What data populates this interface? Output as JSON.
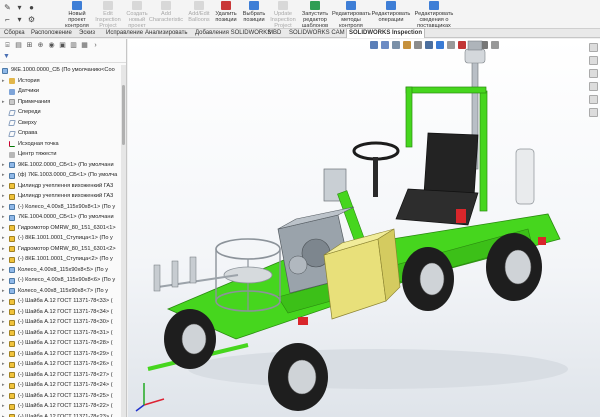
{
  "ribbon": {
    "buttons": [
      {
        "label": "Новый\nпроект\nконтроля",
        "enabled": true,
        "icon": "new-project-icon"
      },
      {
        "label": "Edit\nInspection\nProject",
        "enabled": false,
        "icon": "edit-project-icon"
      },
      {
        "label": "Создать\nновый\nпроект",
        "enabled": false,
        "icon": "create-project-icon"
      },
      {
        "label": "Add\nCharacteristic",
        "enabled": false,
        "icon": "add-characteristic-icon"
      },
      {
        "label": "Add/Edit\nBalloons",
        "enabled": false,
        "icon": "balloons-icon"
      },
      {
        "label": "Удалить\nпозиции",
        "enabled": true,
        "icon": "delete-positions-icon"
      },
      {
        "label": "Выбрать\nпозиции",
        "enabled": true,
        "icon": "select-positions-icon"
      },
      {
        "label": "Update\nInspection\nProject",
        "enabled": false,
        "icon": "update-project-icon"
      },
      {
        "label": "Запустить\nредактор\nшаблонов",
        "enabled": true,
        "icon": "template-editor-icon"
      },
      {
        "label": "Редактировать\nметоды\nконтроля",
        "enabled": true,
        "icon": "edit-methods-icon"
      },
      {
        "label": "Редактировать\nоперации",
        "enabled": true,
        "icon": "edit-operations-icon"
      },
      {
        "label": "Редактировать\nсведения о\nпоставщиках",
        "enabled": true,
        "icon": "edit-suppliers-icon"
      }
    ]
  },
  "tabs": [
    {
      "label": "Сборка",
      "active": false
    },
    {
      "label": "Расположение",
      "active": false
    },
    {
      "label": "Эскиз",
      "active": false
    },
    {
      "label": "Исправление",
      "active": false
    },
    {
      "label": "Анализировать",
      "active": false
    },
    {
      "label": "Добавления SOLIDWORKS",
      "active": false
    },
    {
      "label": "MBD",
      "active": false
    },
    {
      "label": "SOLIDWORKS CAM",
      "active": false
    },
    {
      "label": "SOLIDWORKS Inspection",
      "active": true
    }
  ],
  "tree": {
    "root": "9КЕ.1000.0000_СБ (По умолчанию<Соо",
    "items": [
      {
        "label": "История",
        "icon": "folder-icon",
        "kind": "folder",
        "expand": "▸"
      },
      {
        "label": "Датчики",
        "icon": "sensor-icon",
        "kind": "sensor",
        "expand": ""
      },
      {
        "label": "Примечания",
        "icon": "notes-icon",
        "kind": "note",
        "expand": "▸"
      },
      {
        "label": "Спереди",
        "icon": "plane-icon",
        "kind": "plane",
        "expand": ""
      },
      {
        "label": "Сверху",
        "icon": "plane-icon",
        "kind": "plane",
        "expand": ""
      },
      {
        "label": "Справа",
        "icon": "plane-icon",
        "kind": "plane",
        "expand": ""
      },
      {
        "label": "Исходная точка",
        "icon": "origin-icon",
        "kind": "origin",
        "expand": ""
      },
      {
        "label": "Центр тяжести",
        "icon": "gravity-icon",
        "kind": "gravity",
        "expand": ""
      },
      {
        "label": "9КЕ.1002.0000_СБ<1> (По умолчани",
        "icon": "assembly-icon",
        "kind": "asm",
        "expand": "▸"
      },
      {
        "label": "(ф) 7КЕ.1003.0000_СБ<1> (По умолча",
        "icon": "assembly-icon",
        "kind": "asm",
        "expand": "▸"
      },
      {
        "label": "Цилиндр учеплення вихоженкий ГА3",
        "icon": "part-icon",
        "kind": "part",
        "expand": "▸"
      },
      {
        "label": "Цилиндр учеплення вихоженкий ГА3",
        "icon": "part-icon",
        "kind": "part",
        "expand": "▸"
      },
      {
        "label": "(-) Колесо_4.00х8_115х90х8<1> (По у",
        "icon": "assembly-icon",
        "kind": "asm",
        "expand": "▸"
      },
      {
        "label": "7КЕ.1004.0000_СБ<1> (По умолчани",
        "icon": "assembly-icon",
        "kind": "asm",
        "expand": "▸"
      },
      {
        "label": "Гидромотор OMRW_80_151_6301<1>",
        "icon": "part-icon",
        "kind": "part",
        "expand": "▸"
      },
      {
        "label": "(-) 8КЕ.1001.0001_Ступица<1> (По у",
        "icon": "part-icon",
        "kind": "part",
        "expand": "▸"
      },
      {
        "label": "Гидромотор OMRW_80_151_6301<2>",
        "icon": "part-icon",
        "kind": "part",
        "expand": "▸"
      },
      {
        "label": "(-) 8КЕ.1001.0001_Ступица<2> (По у",
        "icon": "part-icon",
        "kind": "part",
        "expand": "▸"
      },
      {
        "label": "Колесо_4.00х8_115х90х8<5> (По у",
        "icon": "assembly-icon",
        "kind": "asm",
        "expand": "▸"
      },
      {
        "label": "(-) Колесо_4.00х8_115х90х8<6> (По у",
        "icon": "assembly-icon",
        "kind": "asm",
        "expand": "▸"
      },
      {
        "label": "Колесо_4.00х8_115х90х8<7> (По у",
        "icon": "assembly-icon",
        "kind": "asm",
        "expand": "▸"
      },
      {
        "label": "(-) Шайба А.12 ГОСТ 11371-78<33> (",
        "icon": "part-icon",
        "kind": "part",
        "expand": "▸"
      },
      {
        "label": "(-) Шайба А.12 ГОСТ 11371-78<34> (",
        "icon": "part-icon",
        "kind": "part",
        "expand": "▸"
      },
      {
        "label": "(-) Шайба А.12 ГОСТ 11371-78<30> (",
        "icon": "part-icon",
        "kind": "part",
        "expand": "▸"
      },
      {
        "label": "(-) Шайба А.12 ГОСТ 11371-78<31> (",
        "icon": "part-icon",
        "kind": "part",
        "expand": "▸"
      },
      {
        "label": "(-) Шайба А.12 ГОСТ 11371-78<28> (",
        "icon": "part-icon",
        "kind": "part",
        "expand": "▸"
      },
      {
        "label": "(-) Шайба А.12 ГОСТ 11371-78<29> (",
        "icon": "part-icon",
        "kind": "part",
        "expand": "▸"
      },
      {
        "label": "(-) Шайба А.12 ГОСТ 11371-78<26> (",
        "icon": "part-icon",
        "kind": "part",
        "expand": "▸"
      },
      {
        "label": "(-) Шайба А.12 ГОСТ 11371-78<27> (",
        "icon": "part-icon",
        "kind": "part",
        "expand": "▸"
      },
      {
        "label": "(-) Шайба А.12 ГОСТ 11371-78<24> (",
        "icon": "part-icon",
        "kind": "part",
        "expand": "▸"
      },
      {
        "label": "(-) Шайба А.12 ГОСТ 11371-78<25> (",
        "icon": "part-icon",
        "kind": "part",
        "expand": "▸"
      },
      {
        "label": "(-) Шайба А.12 ГОСТ 11371-78<22> (",
        "icon": "part-icon",
        "kind": "part",
        "expand": "▸"
      },
      {
        "label": "(-) Шайба А.12 ГОСТ 11371-78<23> (",
        "icon": "part-icon",
        "kind": "part",
        "expand": "▸"
      }
    ]
  },
  "colors": {
    "frame_green": "#46d61e",
    "frame_dark": "#2a8a10",
    "engine_gray": "#9aa3ab",
    "tank_yellow": "#e8e07a",
    "seat_black": "#232323",
    "accent_red": "#d9262b",
    "tab_active_border": "#bdbdbd"
  }
}
